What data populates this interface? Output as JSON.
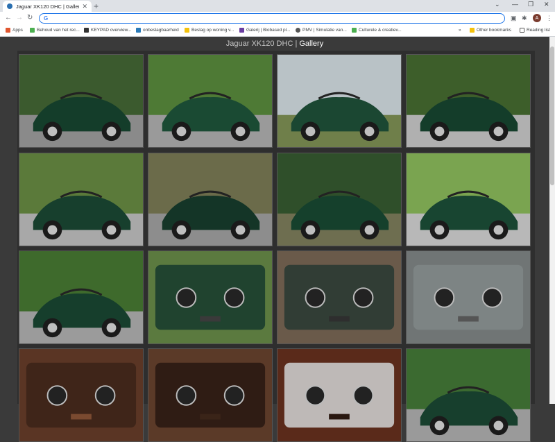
{
  "tab": {
    "title": "Jaguar XK120 DHC | Gallery"
  },
  "omnibox": {
    "value": ""
  },
  "avatar_letter": "A",
  "bookmarks": [
    "Apps",
    "Behoud van het rec...",
    "KEYPAD overview...",
    "onbeslagbaarheid",
    "Beslag op woning v...",
    "Galerij | Biobased pl...",
    "PMV | Simulatie van...",
    "Culturele & creatiev...",
    "»",
    "Other bookmarks",
    "Reading list"
  ],
  "page_title": {
    "main": "Jaguar XK120 DHC",
    "sep": " | ",
    "sub": "Gallery"
  },
  "colors": {
    "chrome_bg": "#dee1e6",
    "accent": "#1a73e8",
    "page_bg": "#3a3a3a"
  },
  "gallery": [
    {
      "scene": "car-front-three-quarter",
      "bg": "#3b5a2e",
      "ground": "#8a8a8a",
      "car": "#143d2a"
    },
    {
      "scene": "car-side-open",
      "bg": "#4e7a35",
      "ground": "#9a9a9a",
      "car": "#1a4a33"
    },
    {
      "scene": "car-side-profile",
      "bg": "#b9c2c6",
      "ground": "#6f7f4a",
      "car": "#1b4732"
    },
    {
      "scene": "car-front-angle",
      "bg": "#3d5e2a",
      "ground": "#b0b0b0",
      "car": "#143d2a"
    },
    {
      "scene": "car-rear-three-quarter",
      "bg": "#5b7a3a",
      "ground": "#a8a8a8",
      "car": "#173f2d"
    },
    {
      "scene": "car-rear",
      "bg": "#6b6b4a",
      "ground": "#8d8d8d",
      "car": "#143527"
    },
    {
      "scene": "car-front-grille",
      "bg": "#2f4f2a",
      "ground": "#6e6e50",
      "car": "#15402c"
    },
    {
      "scene": "car-front-side",
      "bg": "#7aa450",
      "ground": "#b8b8b8",
      "car": "#184531"
    },
    {
      "scene": "car-side-convertible",
      "bg": "#3e6a2c",
      "ground": "#9b9b9b",
      "car": "#163e2c"
    },
    {
      "scene": "door-interior",
      "bg": "#5b7a3f",
      "ground": "#3a3a3a",
      "car": "#1a3d2d"
    },
    {
      "scene": "door-panel",
      "bg": "#6a5a4a",
      "ground": "#2e2e2e",
      "car": "#2b3a33"
    },
    {
      "scene": "seat-interior",
      "bg": "#707575",
      "ground": "#555",
      "car": "#7e8686"
    },
    {
      "scene": "dashboard",
      "bg": "#5a3524",
      "ground": "#7a4a30",
      "car": "#3c2418"
    },
    {
      "scene": "dashboard-gauges",
      "bg": "#5b3a28",
      "ground": "#3a2418",
      "car": "#2a1a12"
    },
    {
      "scene": "radio-console",
      "bg": "#5a2a1a",
      "ground": "#2a1810",
      "car": "#c9c9c9"
    },
    {
      "scene": "car-top-up",
      "bg": "#3b6a30",
      "ground": "#9a9a9a",
      "car": "#173f2d"
    }
  ]
}
